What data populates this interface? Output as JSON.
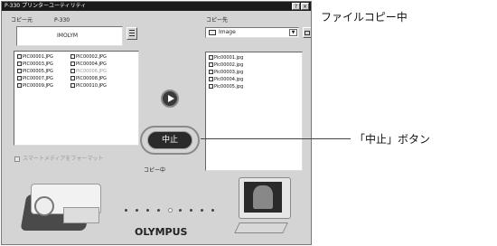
{
  "window": {
    "title": "P-330 プリンターユーティリティ",
    "help_label": "?",
    "close_label": "×"
  },
  "source": {
    "label": "コピー元",
    "device": "P-330",
    "volume": "IMOLYM",
    "files": [
      "PIC00001.JPG",
      "PIC00002.JPG",
      "PIC00003.JPG",
      "PIC00004.JPG",
      "PIC00005.JPG",
      "PIC00006.JPG",
      "PIC00007.JPG",
      "PIC00008.JPG",
      "PIC00009.JPG",
      "PIC00010.JPG"
    ]
  },
  "dest": {
    "label": "コピー先",
    "folder": "Image",
    "files": [
      "Pic00001.jpg",
      "Pic00002.jpg",
      "Pic00003.jpg",
      "Pic00004.jpg",
      "Pic00005.jpg"
    ]
  },
  "stop_button_label": "中止",
  "status_text": "コピー中",
  "checkbox_label": "スマートメディアをフォーマット",
  "logo_text": "OLYMPUS",
  "annotations": {
    "copying": "ファイルコピー中",
    "stop_button": "「中止」ボタン"
  },
  "colors": {
    "window_bg": "#d4d4d4",
    "titlebar": "#1a1a1a",
    "stop_button": "#2a2a2a"
  }
}
